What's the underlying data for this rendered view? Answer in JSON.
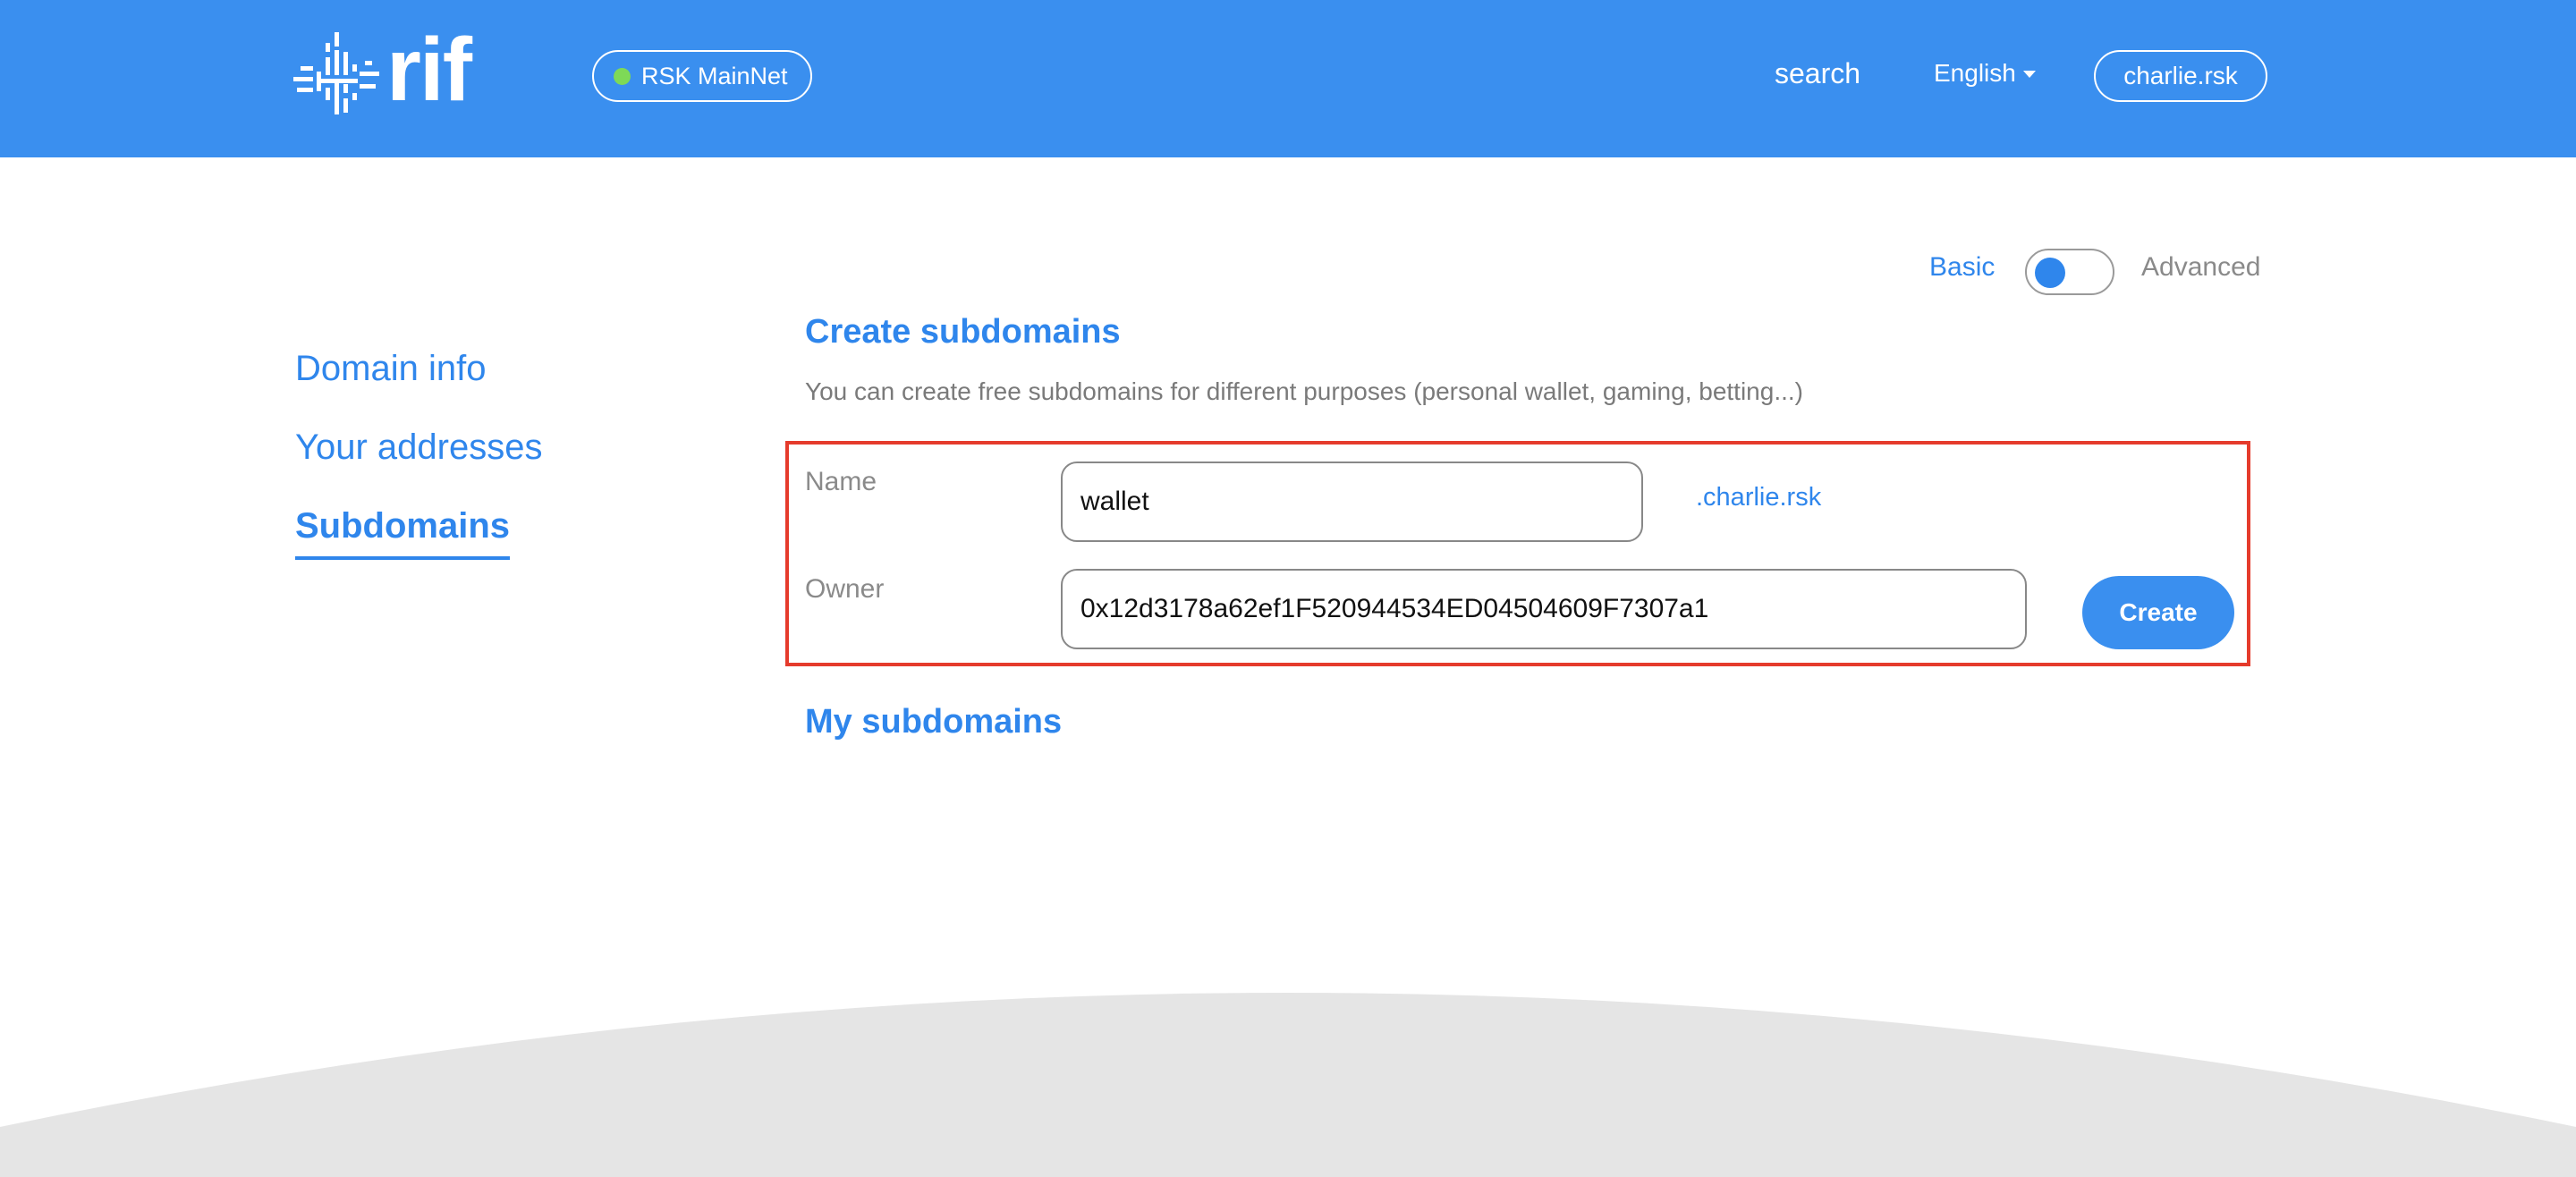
{
  "header": {
    "logo_text": "rif",
    "network": {
      "label": "RSK MainNet",
      "status_color": "#7ed957"
    },
    "search_label": "search",
    "language": "English",
    "account": "charlie.rsk"
  },
  "mode_toggle": {
    "basic_label": "Basic",
    "advanced_label": "Advanced",
    "selected": "Basic"
  },
  "sidebar": {
    "items": [
      {
        "label": "Domain info"
      },
      {
        "label": "Your addresses"
      },
      {
        "label": "Subdomains"
      }
    ],
    "active": "Subdomains"
  },
  "main": {
    "create_title": "Create subdomains",
    "create_description": "You can create free subdomains for different purposes (personal wallet, gaming, betting...)",
    "form": {
      "name_label": "Name",
      "name_value": "wallet",
      "domain_suffix": ".charlie.rsk",
      "owner_label": "Owner",
      "owner_value": "0x12d3178a62ef1F520944534ED04504609F7307a1",
      "create_button": "Create"
    },
    "my_subdomains_title": "My subdomains"
  },
  "colors": {
    "brand_blue": "#3a8fef",
    "link_blue": "#2f86ec",
    "highlight_red": "#e53b2c",
    "footer_gray": "#e5e5e5"
  }
}
